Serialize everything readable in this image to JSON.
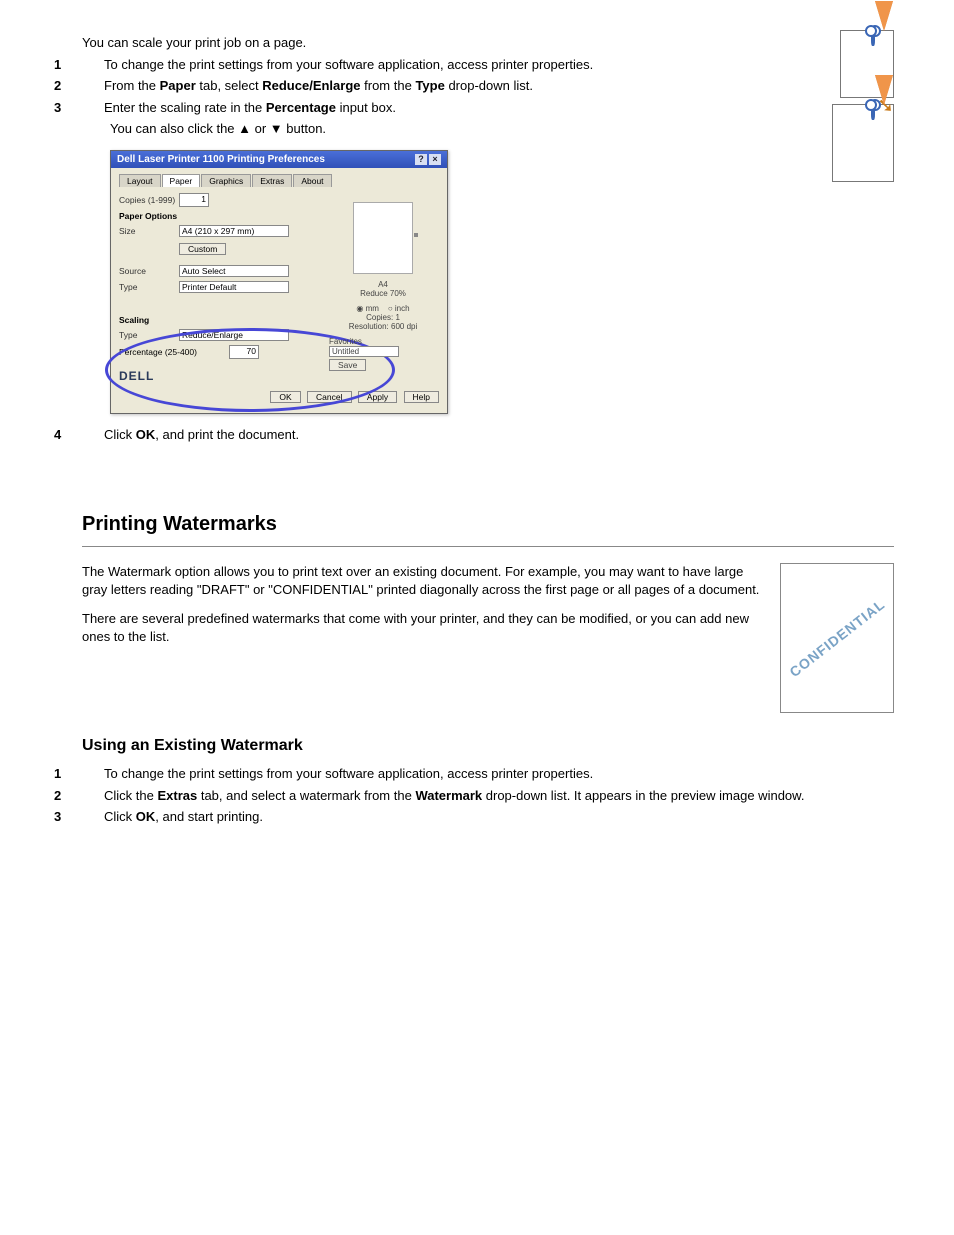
{
  "section1": {
    "p1": "You can scale your print job on a page.",
    "step1_num": "1",
    "step1": "To change the print settings from your software application, access printer properties.",
    "step2_num": "2",
    "step2_a": "From the ",
    "step2_tab": "Paper",
    "step2_b": " tab, select ",
    "step2_opt": "Reduce/Enlarge",
    "step2_c": " from the ",
    "step2_dd": "Type",
    "step2_d": " drop-down list.",
    "step3_num": "3",
    "step3_a": "Enter the scaling rate in the ",
    "step3_field": "Percentage",
    "step3_b": " input box.",
    "step3_sub": "You can also click the ▲ or ▼ button.",
    "step4_num": "4",
    "step4_a": "Click ",
    "step4_btn": "OK",
    "step4_b": ", and print the document."
  },
  "dialog": {
    "title": "Dell Laser Printer 1100 Printing Preferences",
    "tabs": {
      "layout": "Layout",
      "paper": "Paper",
      "graphics": "Graphics",
      "extras": "Extras",
      "about": "About"
    },
    "copies_lbl": "Copies (1-999)",
    "copies_val": "1",
    "options_hdr": "Paper Options",
    "size_lbl": "Size",
    "size_val": "A4 (210 x 297 mm)",
    "size_btn": "Custom",
    "source_lbl": "Source",
    "source_val": "Auto Select",
    "type_lbl": "Type",
    "type_val": "Printer Default",
    "scaling_hdr": "Scaling",
    "scaling_type_lbl": "Type",
    "scaling_type_val": "Reduce/Enlarge",
    "pct_lbl": "Percentage (25-400)",
    "pct_val": "70",
    "preview_name": "A4",
    "preview_scale": "Reduce 70%",
    "mm": "mm",
    "inch": "inch",
    "copies_info": "Copies: 1",
    "res_info": "Resolution: 600 dpi",
    "fav_lbl": "Favorites",
    "fav_val": "Untitled",
    "fav_btn": "Save",
    "brand": "DELL",
    "ok": "OK",
    "cancel": "Cancel",
    "apply": "Apply",
    "help": "Help"
  },
  "watermark": {
    "heading": "Printing Watermarks",
    "p1": "The Watermark option allows you to print text over an existing document. For example, you may want to have large gray letters reading \"DRAFT\" or \"CONFIDENTIAL\" printed diagonally across the first page or all pages of a document.",
    "p2": "There are several predefined watermarks that come with your printer, and they can be modified, or you can add new ones to the list.",
    "thumb_text": "CONFIDENTIAL",
    "sub_heading": "Using an Existing Watermark",
    "s1_num": "1",
    "s1": "To change the print settings from your software application, access printer properties.",
    "s2_num": "2",
    "s2_a": "Click the ",
    "s2_tab": "Extras",
    "s2_b": " tab, and select a watermark from the ",
    "s2_dd": "Watermark",
    "s2_c": " drop-down list. It appears in the preview image window.",
    "s3_num": "3",
    "s3_a": "Click ",
    "s3_btn": "OK",
    "s3_b": ", and start printing."
  }
}
